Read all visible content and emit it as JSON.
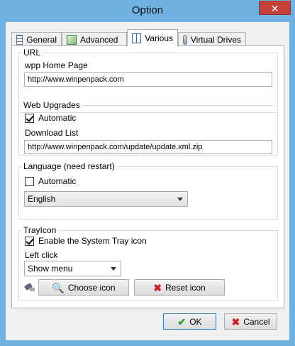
{
  "window": {
    "title": "Option",
    "close_glyph": "✕"
  },
  "tabs": [
    {
      "label": "General",
      "icon": "grid-icon"
    },
    {
      "label": "Advanced",
      "icon": "advanced-icon"
    },
    {
      "label": "Various",
      "icon": "various-icon"
    },
    {
      "label": "Virtual Drives",
      "icon": "drives-icon"
    }
  ],
  "url_group": {
    "legend": "URL",
    "home_label": "wpp Home Page",
    "home_value": "http://www.winpenpack.com"
  },
  "web_group": {
    "legend": "Web Upgrades",
    "automatic_label": "Automatic",
    "automatic_checked": true,
    "download_label": "Download List",
    "download_value": "http://www.winpenpack.com/update/update.xml.zip"
  },
  "language_group": {
    "legend": "Language (need restart)",
    "automatic_label": "Automatic",
    "automatic_checked": false,
    "selected": "English"
  },
  "tray_group": {
    "legend": "TrayIcon",
    "enable_label": "Enable the System Tray icon",
    "enable_checked": true,
    "left_click_label": "Left click",
    "left_click_selected": "Show menu",
    "choose_label": "Choose icon",
    "reset_label": "Reset icon"
  },
  "footer": {
    "ok_label": "OK",
    "cancel_label": "Cancel"
  },
  "colors": {
    "frame": "#6fb1e0",
    "close": "#c7413a",
    "ok_check": "#2a9a2a",
    "cancel_x": "#d02020"
  }
}
